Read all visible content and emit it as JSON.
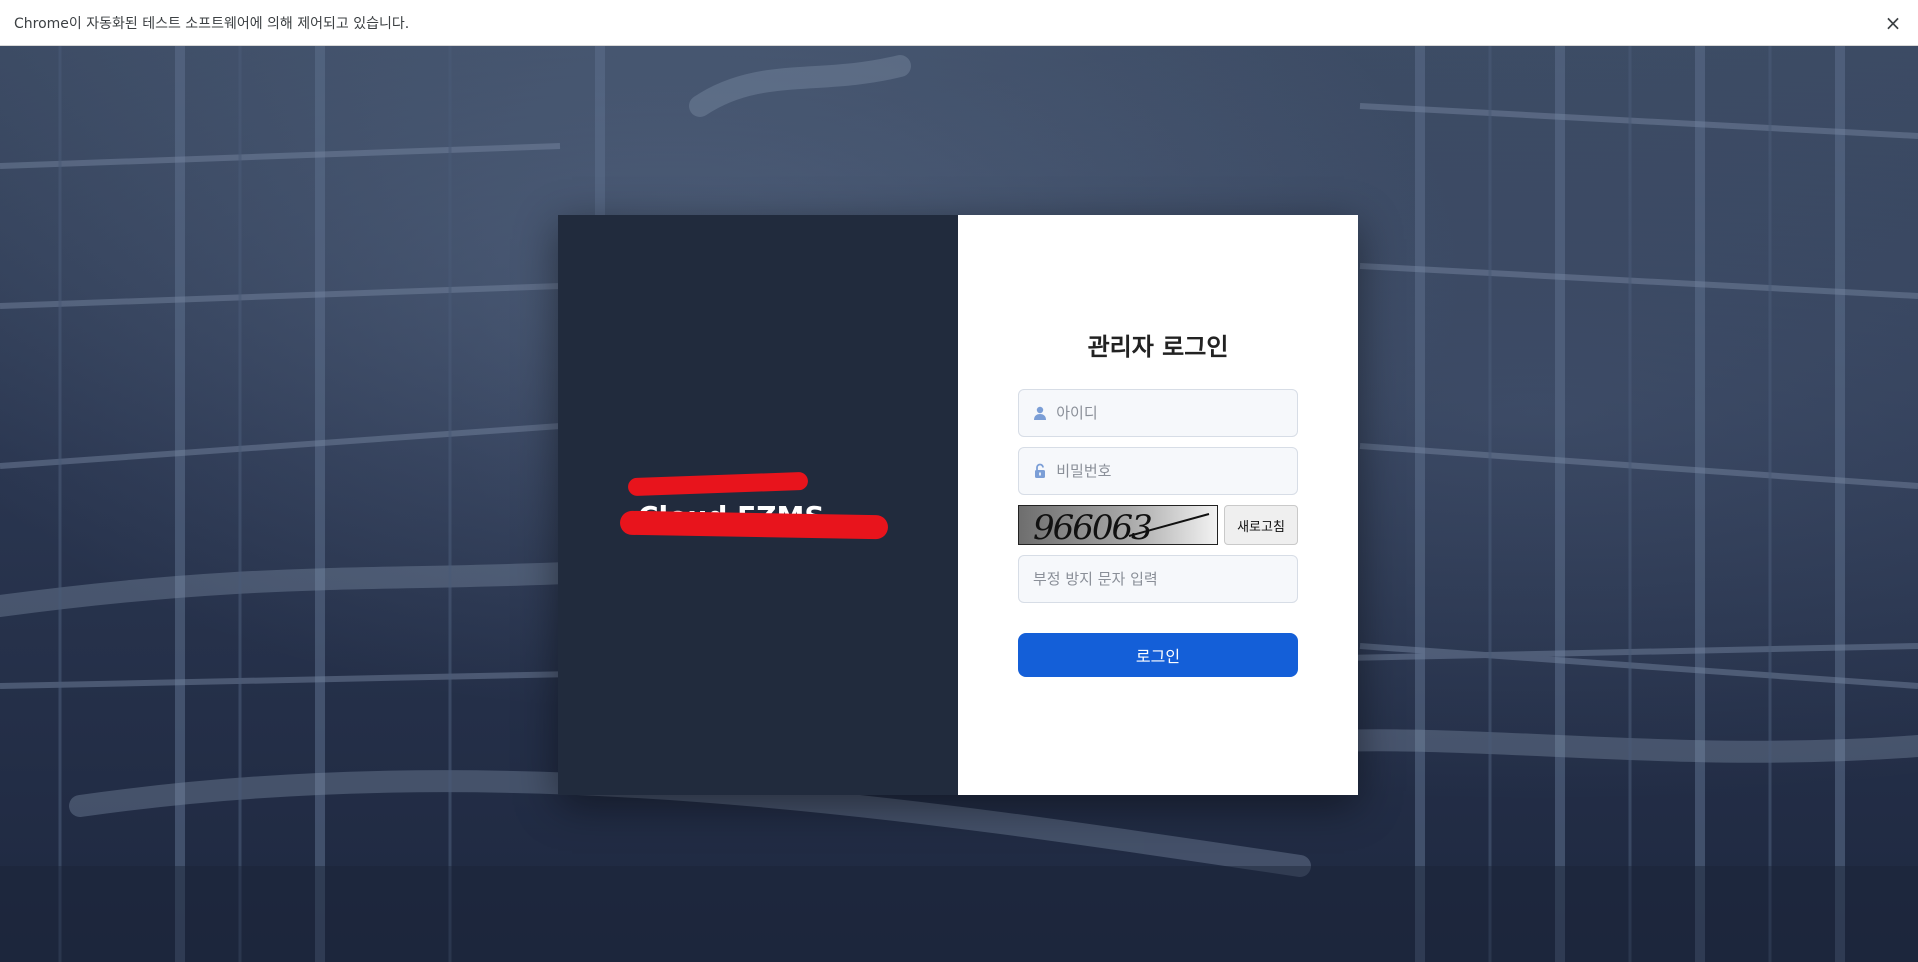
{
  "infobar": {
    "message": "Chrome이 자동화된 테스트 소프트웨어에 의해 제어되고 있습니다.",
    "close_icon": "×"
  },
  "brand": {
    "line1": "",
    "line2": "Cloud EZMS"
  },
  "login": {
    "title": "관리자 로그인",
    "id_placeholder": "아이디",
    "pw_placeholder": "비밀번호",
    "captcha_text": "966063",
    "refresh_label": "새로고침",
    "captcha_placeholder": "부정 방지 문자 입력",
    "submit_label": "로그인"
  },
  "colors": {
    "accent": "#145fd8",
    "left_panel": "#212b3d",
    "redaction": "#e8141c"
  }
}
